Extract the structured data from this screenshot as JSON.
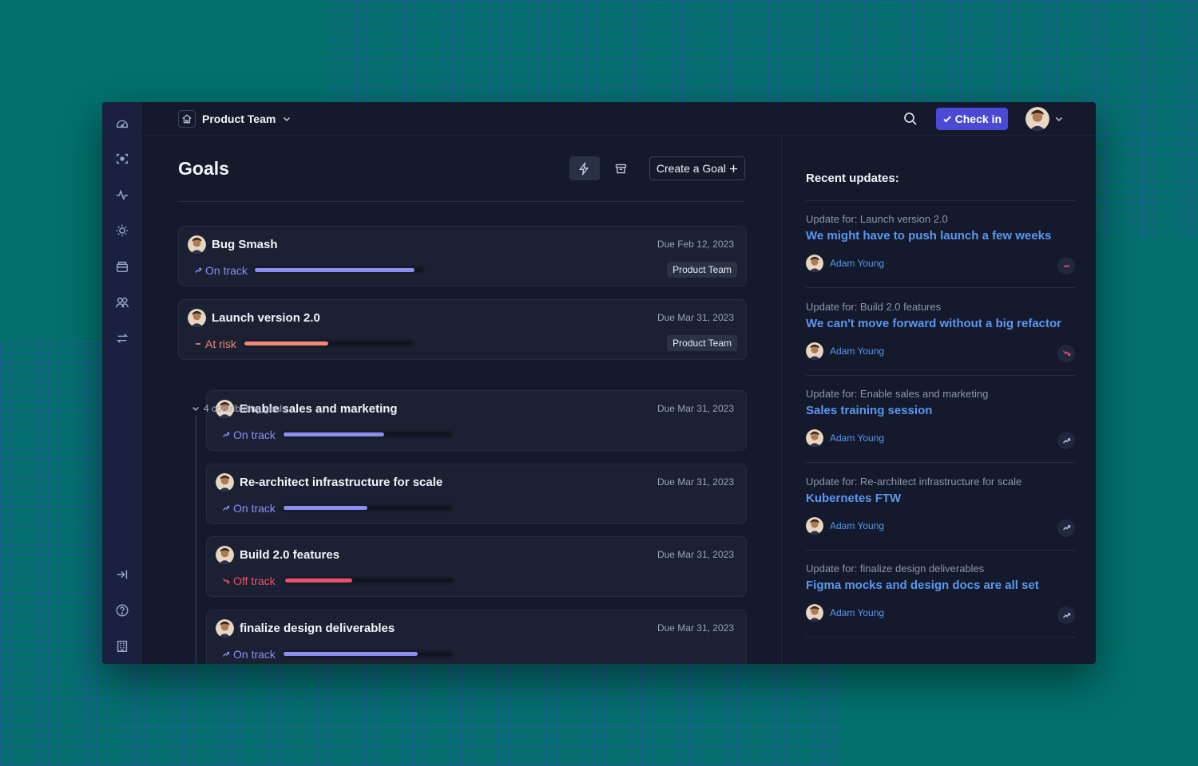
{
  "colors": {
    "on_track": "#8b8ef5",
    "at_risk": "#f08a74",
    "off_track": "#ef4f6a",
    "link": "#5a97f0",
    "accent": "#4a4ad6"
  },
  "rail": {
    "top_icons": [
      "dashboard-icon",
      "focus-icon",
      "activity-icon",
      "lightbulb-icon",
      "inbox-icon",
      "people-icon",
      "swap-icon"
    ],
    "bottom_icons": [
      "expand-sidebar-icon",
      "help-icon",
      "company-icon"
    ]
  },
  "topbar": {
    "team_name": "Product Team",
    "check_in_label": "Check in"
  },
  "goals": {
    "title": "Goals",
    "create_label": "Create a Goal",
    "contributing_label": "4 contributing goals",
    "items": [
      {
        "name": "Bug Smash",
        "due": "Due Feb 12, 2023",
        "status": "On track",
        "progress": 0.95,
        "team": "Product Team"
      },
      {
        "name": "Launch version 2.0",
        "due": "Due Mar 31, 2023",
        "status": "At risk",
        "progress": 0.5,
        "team": "Product Team"
      },
      {
        "name": "Enable sales and marketing",
        "due": "Due Mar 31, 2023",
        "status": "On track",
        "progress": 0.6
      },
      {
        "name": "Re-architect infrastructure for scale",
        "due": "Due Mar 31, 2023",
        "status": "On track",
        "progress": 0.5
      },
      {
        "name": "Build 2.0 features",
        "due": "Due Mar 31, 2023",
        "status": "Off track",
        "progress": 0.4
      },
      {
        "name": "finalize design deliverables",
        "due": "Due Mar 31, 2023",
        "status": "On track",
        "progress": 0.8
      }
    ]
  },
  "updates": {
    "title": "Recent updates:",
    "items": [
      {
        "for": "Update for: Launch version 2.0",
        "title": "We might have to push launch a few weeks",
        "author": "Adam Young",
        "status_icon": "at-risk-icon"
      },
      {
        "for": "Update for: Build 2.0 features",
        "title": "We can't move forward without a big refactor",
        "author": "Adam Young",
        "status_icon": "off-track-icon"
      },
      {
        "for": "Update for: Enable sales and marketing",
        "title": "Sales training session",
        "author": "Adam Young",
        "status_icon": "on-track-icon"
      },
      {
        "for": "Update for: Re-architect infrastructure for scale",
        "title": "Kubernetes FTW",
        "author": "Adam Young",
        "status_icon": "on-track-icon"
      },
      {
        "for": "Update for: finalize design deliverables",
        "title": "Figma mocks and design docs are all set",
        "author": "Adam Young",
        "status_icon": "on-track-icon"
      }
    ]
  }
}
